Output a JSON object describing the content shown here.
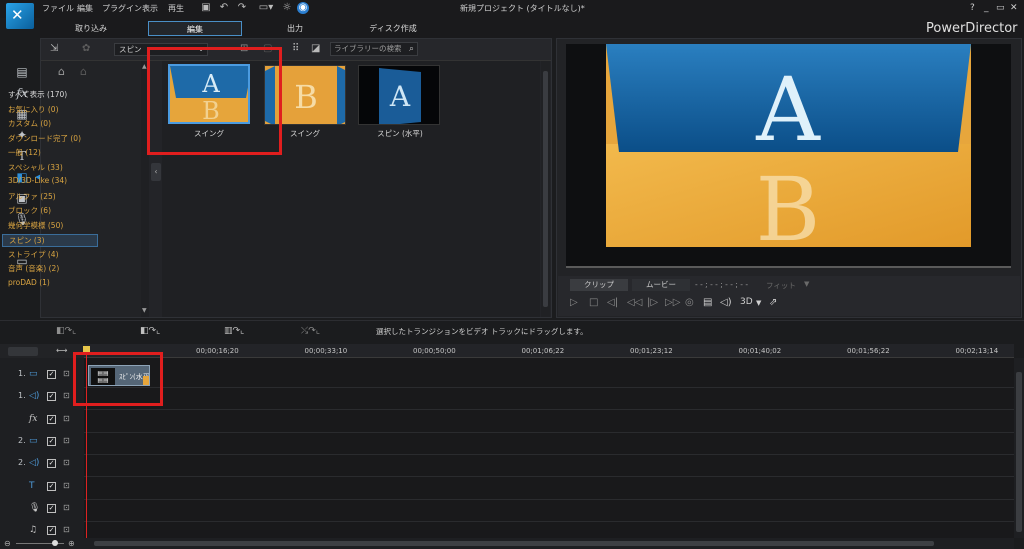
{
  "window": {
    "title": "新規プロジェクト (タイトルなし)*",
    "app_name": "PowerDirector",
    "controls": [
      "?",
      "_",
      "▭",
      "✕"
    ]
  },
  "menu": [
    "ファイル",
    "編集",
    "プラグイン",
    "表示",
    "再生"
  ],
  "modes": [
    "取り込み",
    "編集",
    "出力",
    "ディスク作成"
  ],
  "active_mode": "編集",
  "library": {
    "filter": "スピン",
    "search_placeholder": "ライブラリーの検索",
    "categories": [
      {
        "label": "すべて表示 (170)",
        "style": "plain"
      },
      {
        "label": "お気に入り (0)",
        "style": "accent"
      },
      {
        "label": "カスタム (0)",
        "style": "accent"
      },
      {
        "label": "ダウンロード完了 (0)",
        "style": "accent"
      },
      {
        "label": "一般 (12)",
        "style": "accent"
      },
      {
        "label": "スペシャル (33)",
        "style": "accent"
      },
      {
        "label": "3D/3D-Like (34)",
        "style": "accent"
      },
      {
        "label": "アルファ (25)",
        "style": "accent"
      },
      {
        "label": "ブロック (6)",
        "style": "accent"
      },
      {
        "label": "幾何学模様 (50)",
        "style": "accent"
      },
      {
        "label": "スピン (3)",
        "style": "selected"
      },
      {
        "label": "ストライプ (4)",
        "style": "accent"
      },
      {
        "label": "音声 (音楽) (2)",
        "style": "accent"
      },
      {
        "label": "proDAD (1)",
        "style": "accent"
      }
    ],
    "thumbnails": [
      {
        "label": "スイング",
        "selected": true
      },
      {
        "label": "スイング",
        "selected": false
      },
      {
        "label": "スピン (水平)",
        "selected": false
      }
    ]
  },
  "preview": {
    "tabs": [
      "クリップ",
      "ムービー"
    ],
    "timecode": "- - ; - - ; - - ; - -",
    "fit_label": "フィット",
    "threed_label": "3D"
  },
  "timeline": {
    "hint": "選択したトランジションをビデオ トラックにドラッグします。",
    "ruler_labels": [
      "00;00;16;20",
      "00;00;33;10",
      "00;00;50;00",
      "00;01;06;22",
      "00;01;23;12",
      "00;01;40;02",
      "00;01;56;22",
      "00;02;13;14"
    ],
    "tracks": [
      {
        "num": "1.",
        "kind": "video"
      },
      {
        "num": "1.",
        "kind": "audio"
      },
      {
        "num": "",
        "kind": "fx"
      },
      {
        "num": "2.",
        "kind": "video"
      },
      {
        "num": "2.",
        "kind": "audio"
      },
      {
        "num": "",
        "kind": "title"
      },
      {
        "num": "",
        "kind": "voice"
      },
      {
        "num": "",
        "kind": "music"
      }
    ],
    "clip_label": "ｽﾋﾟﾝ(水平)"
  },
  "colors": {
    "accent": "#4b9be0",
    "category_text": "#d9a441",
    "highlight_box": "#e01e1e"
  }
}
